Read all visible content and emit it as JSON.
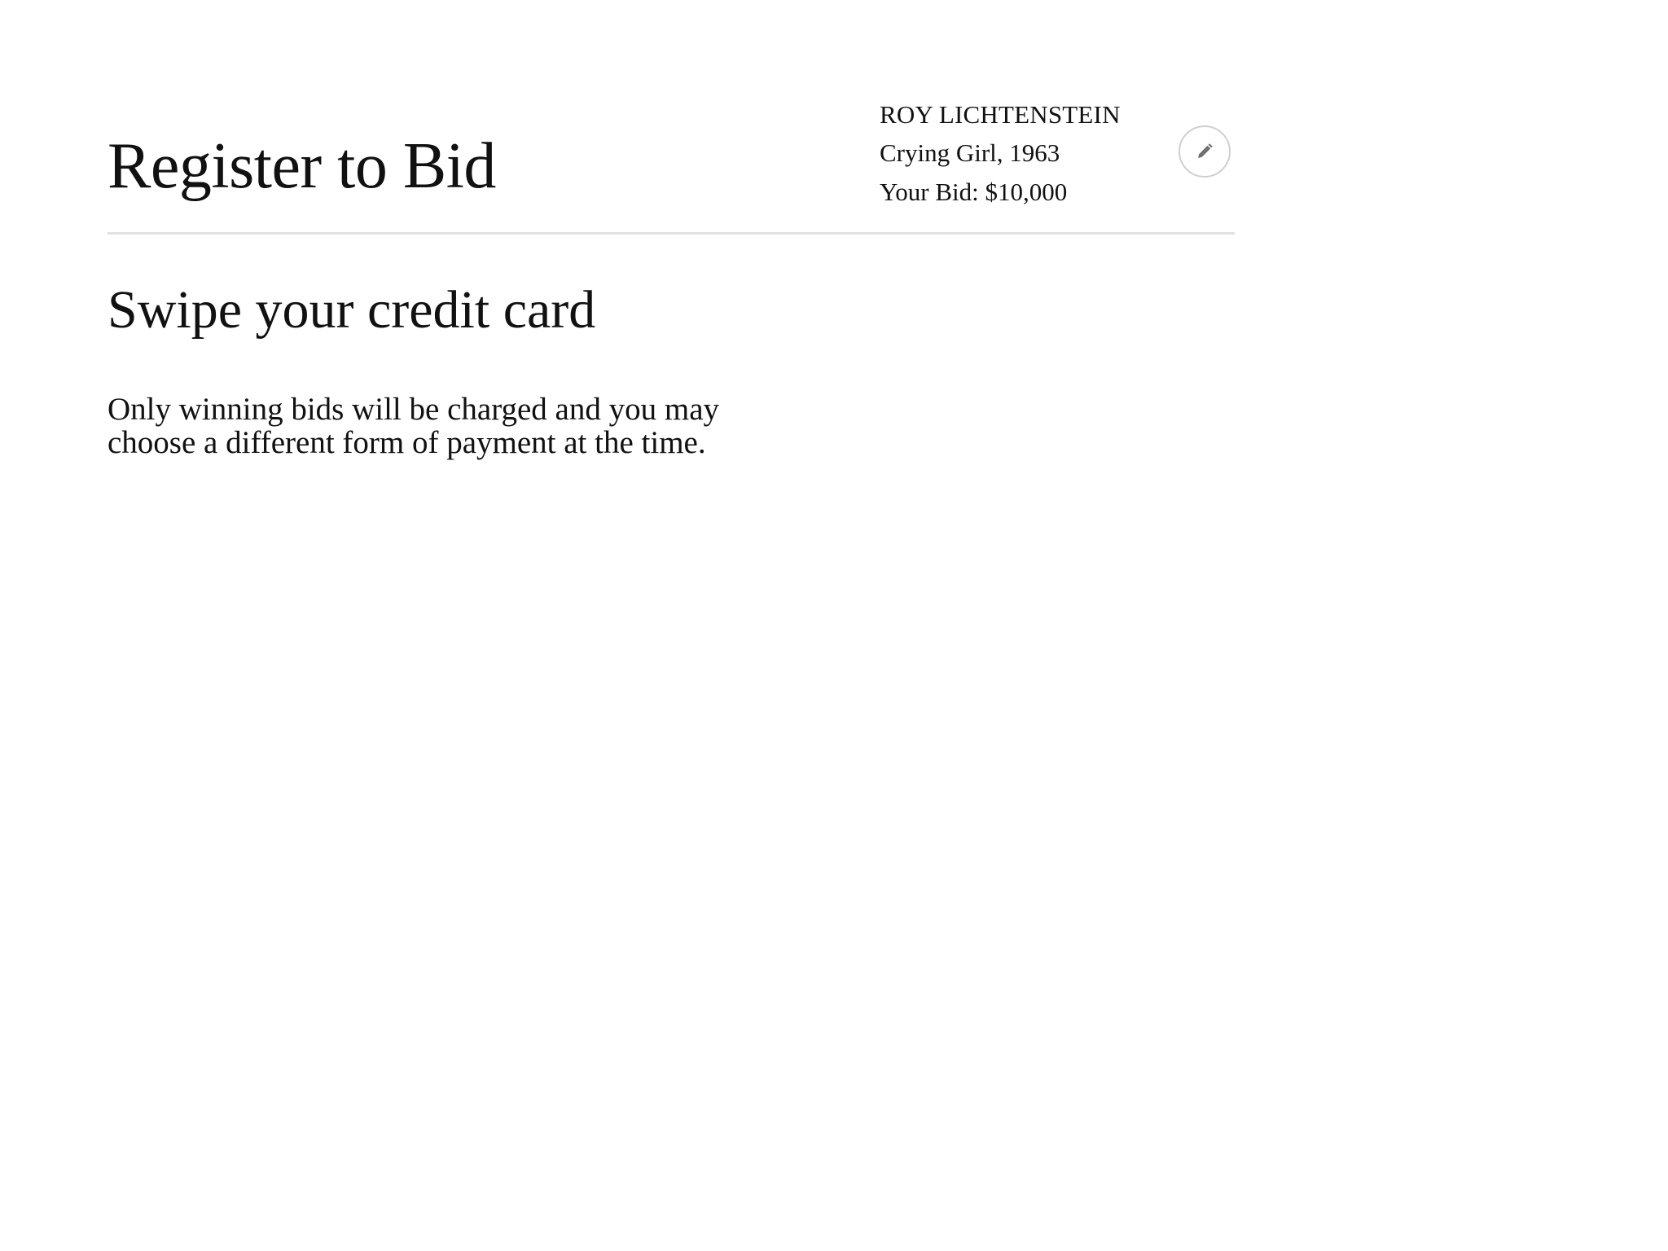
{
  "header": {
    "title": "Register to Bid"
  },
  "lot": {
    "artist": "ROY LICHTENSTEIN",
    "work": "Crying Girl, 1963",
    "bid": "Your Bid: $10,000",
    "edit_icon": "pencil-icon"
  },
  "step": {
    "title": "Swipe your credit card",
    "note_line1": "Only winning bids will be charged and you may",
    "note_line2": "choose a different form of payment at the time."
  },
  "colors": {
    "background": "#ffffff",
    "text": "#111111",
    "divider": "#e1e1e1",
    "button_border": "#cfcfcf",
    "icon": "#6f6f6f"
  }
}
